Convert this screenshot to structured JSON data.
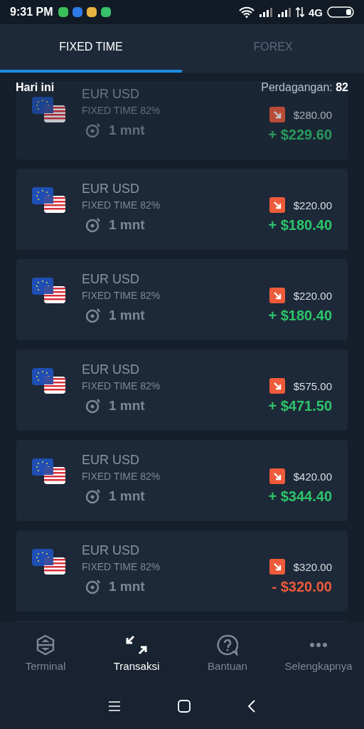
{
  "status_bar": {
    "time": "9:31 PM",
    "network": "4G"
  },
  "tabs": [
    {
      "label": "FIXED TIME",
      "selected": true
    },
    {
      "label": "FOREX",
      "selected": false
    }
  ],
  "summary": {
    "label": "Hari ini",
    "trades_label": "Perdagangan:",
    "trades_count": "82"
  },
  "trades": [
    {
      "pair": "EUR USD",
      "mode": "FIXED TIME 82%",
      "duration": "1 mnt",
      "amount": "$280.00",
      "result": "+ $229.60",
      "loss": false
    },
    {
      "pair": "EUR USD",
      "mode": "FIXED TIME 82%",
      "duration": "1 mnt",
      "amount": "$220.00",
      "result": "+ $180.40",
      "loss": false
    },
    {
      "pair": "EUR USD",
      "mode": "FIXED TIME 82%",
      "duration": "1 mnt",
      "amount": "$220.00",
      "result": "+ $180.40",
      "loss": false
    },
    {
      "pair": "EUR USD",
      "mode": "FIXED TIME 82%",
      "duration": "1 mnt",
      "amount": "$575.00",
      "result": "+ $471.50",
      "loss": false
    },
    {
      "pair": "EUR USD",
      "mode": "FIXED TIME 82%",
      "duration": "1 mnt",
      "amount": "$420.00",
      "result": "+ $344.40",
      "loss": false
    },
    {
      "pair": "EUR USD",
      "mode": "FIXED TIME 82%",
      "duration": "1 mnt",
      "amount": "$320.00",
      "result": "- $320.00",
      "loss": true
    }
  ],
  "bottom_nav": [
    {
      "label": "Terminal",
      "kind": "terminal",
      "selected": false
    },
    {
      "label": "Transaksi",
      "kind": "transactions",
      "selected": true
    },
    {
      "label": "Bantuan",
      "kind": "help",
      "selected": false
    },
    {
      "label": "Selengkapnya",
      "kind": "more",
      "selected": false
    }
  ]
}
